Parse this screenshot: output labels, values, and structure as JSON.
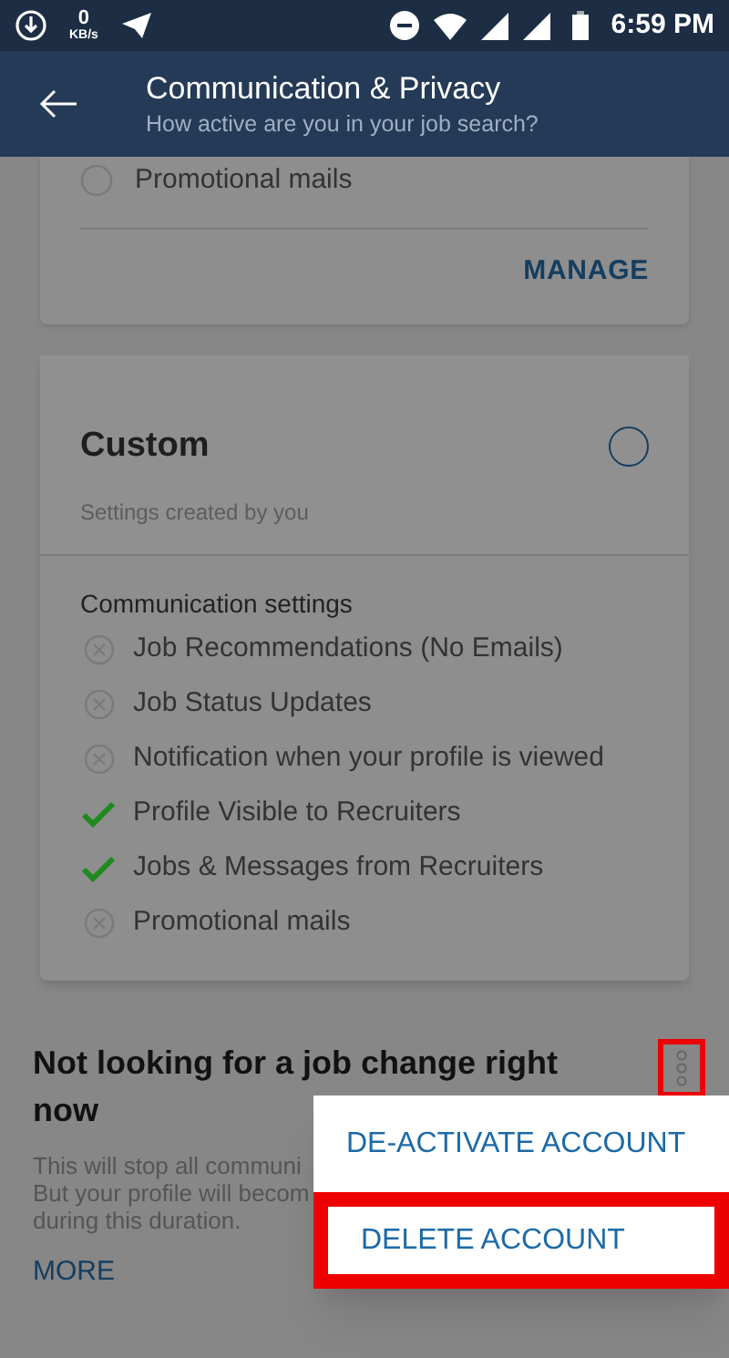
{
  "status_bar": {
    "speed": "0",
    "speed_unit": "KB/s",
    "time": "6:59 PM"
  },
  "header": {
    "title": "Communication & Privacy",
    "subtitle": "How active are you in your job search?"
  },
  "top_card": {
    "partial_item": "Promotional mails",
    "action": "MANAGE"
  },
  "custom_card": {
    "title": "Custom",
    "subtitle": "Settings created by you",
    "selected": false,
    "section_title": "Communication settings",
    "settings": [
      {
        "label": "Job Recommendations (No Emails)",
        "enabled": false
      },
      {
        "label": "Job Status Updates",
        "enabled": false
      },
      {
        "label": "Notification when your profile is viewed",
        "enabled": false
      },
      {
        "label": "Profile Visible to Recruiters",
        "enabled": true
      },
      {
        "label": "Jobs & Messages from Recruiters",
        "enabled": true
      },
      {
        "label": "Promotional mails",
        "enabled": false
      }
    ]
  },
  "inactive_section": {
    "title": "Not looking for a job change right now",
    "description_lines": [
      "This will stop all communi",
      "But your profile will becom",
      "during this duration."
    ],
    "link": "MORE",
    "menu_button_highlighted": true
  },
  "menu": {
    "items": [
      {
        "label": "DE-ACTIVATE ACCOUNT",
        "highlighted": false
      },
      {
        "label": "DELETE ACCOUNT",
        "highlighted": true
      }
    ]
  }
}
